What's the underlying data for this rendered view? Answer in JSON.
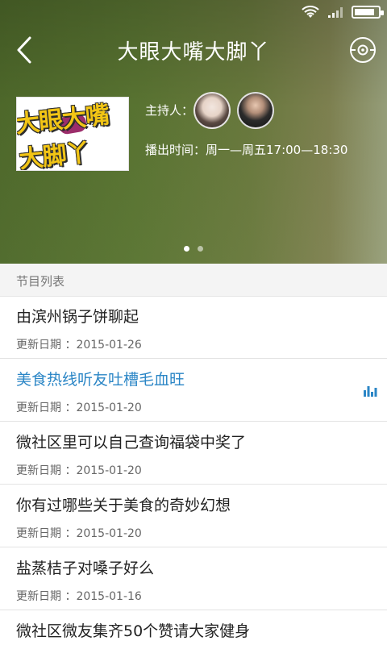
{
  "topbar": {
    "title": "大眼大嘴大脚丫"
  },
  "program": {
    "host_label": "主持人：",
    "airtime": "播出时间：周一—周五17:00—18:30",
    "cover_logo_text": "大眼大嘴大脚丫"
  },
  "carousel": {
    "pages": 2,
    "active": 1
  },
  "section": {
    "label": "节目列表"
  },
  "episodes": [
    {
      "title": "由滨州锅子饼聊起",
      "date": "更新日期 ：2015-01-26",
      "playing": false
    },
    {
      "title": "美食热线听友吐槽毛血旺",
      "date": "更新日期 ：2015-01-20",
      "playing": true
    },
    {
      "title": "微社区里可以自己查询福袋中奖了",
      "date": "更新日期 ：2015-01-20",
      "playing": false
    },
    {
      "title": "你有过哪些关于美食的奇妙幻想",
      "date": "更新日期 ：2015-01-20",
      "playing": false
    },
    {
      "title": "盐蒸桔子对嗓子好么",
      "date": "更新日期 ：2015-01-16",
      "playing": false
    },
    {
      "title": "微社区微友集齐50个赞请大家健身",
      "date": "",
      "playing": false
    }
  ],
  "status": {
    "battery_level": 0.85
  },
  "colors": {
    "accent": "#2b86c6",
    "hero_green": "#5a7532"
  },
  "icons": {
    "back": "back-arrow-icon",
    "target": "target-icon",
    "equalizer": "equalizer-icon",
    "wifi": "wifi-icon",
    "signal": "signal-icon",
    "battery": "battery-icon"
  }
}
